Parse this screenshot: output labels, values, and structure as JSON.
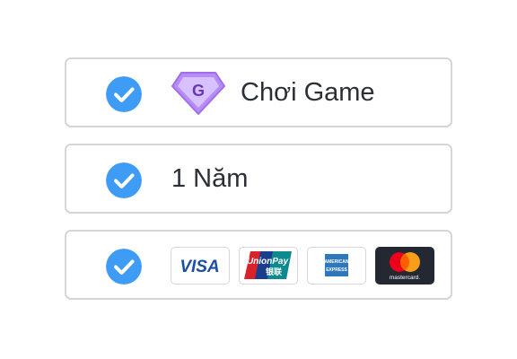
{
  "options": [
    {
      "label": "Chơi Game",
      "badge_letter": "G",
      "icon": "gem-icon",
      "selected": true
    },
    {
      "label": "1 Năm",
      "selected": true
    },
    {
      "selected": true,
      "payment_methods": [
        "visa",
        "unionpay",
        "american-express",
        "mastercard"
      ]
    }
  ],
  "cards": {
    "visa": "VISA",
    "unionpay": "UnionPay",
    "unionpay_sub": "银联",
    "amex_top": "AMERICAN",
    "amex_bottom": "EXPRESS",
    "mastercard": "mastercard."
  },
  "colors": {
    "check": "#3f9cf6",
    "border": "#d3d6da",
    "text": "#2b2f36",
    "gem": "#c9a8ff",
    "gem_dark": "#9f6ee8"
  }
}
